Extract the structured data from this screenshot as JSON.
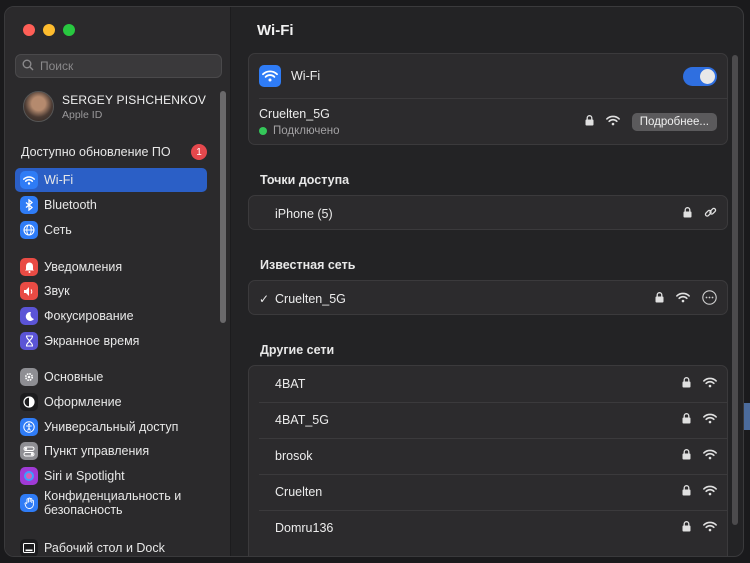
{
  "window": {
    "traffic": [
      "#ff5f57",
      "#febc2e",
      "#28c840"
    ]
  },
  "search": {
    "placeholder": "Поиск"
  },
  "profile": {
    "name": "SERGEY PISHCHENKOV",
    "sub": "Apple ID"
  },
  "update": {
    "label": "Доступно обновление ПО",
    "count": "1"
  },
  "sidebar": {
    "items": [
      {
        "label": "Wi-Fi",
        "icon": "wifi-icon",
        "color": "#2f7cf6",
        "active": true
      },
      {
        "label": "Bluetooth",
        "icon": "bluetooth-icon",
        "color": "#2f7cf6"
      },
      {
        "label": "Сеть",
        "icon": "globe-icon",
        "color": "#2f7cf6"
      },
      {
        "label": "Уведомления",
        "icon": "bell-icon",
        "color": "#e94b44"
      },
      {
        "label": "Звук",
        "icon": "speaker-icon",
        "color": "#e94b44"
      },
      {
        "label": "Фокусирование",
        "icon": "moon-icon",
        "color": "#5b54d6"
      },
      {
        "label": "Экранное время",
        "icon": "hourglass-icon",
        "color": "#5b54d6"
      },
      {
        "label": "Основные",
        "icon": "gear-icon",
        "color": "#8e8e93"
      },
      {
        "label": "Оформление",
        "icon": "appearance-icon",
        "color": "#1c1c1e"
      },
      {
        "label": "Универсальный доступ",
        "icon": "accessibility-icon",
        "color": "#2f7cf6"
      },
      {
        "label": "Пункт управления",
        "icon": "control-center-icon",
        "color": "#8e8e93"
      },
      {
        "label": "Siri и Spotlight",
        "icon": "siri-icon",
        "color": "#a03ad6"
      },
      {
        "label": "Конфиденциальность и безопасность",
        "icon": "hand-icon",
        "color": "#2f7cf6"
      },
      {
        "label": "Рабочий стол и Dock",
        "icon": "dock-icon",
        "color": "#1c1c1e"
      }
    ]
  },
  "main": {
    "title": "Wi-Fi",
    "wifi_label": "Wi-Fi",
    "current": {
      "name": "Cruelten_5G",
      "status": "Подключено",
      "details_button": "Подробнее..."
    },
    "hotspots_title": "Точки доступа",
    "hotspots": [
      {
        "name": "iPhone (5)"
      }
    ],
    "known_title": "Известная сеть",
    "known": [
      {
        "name": "Cruelten_5G",
        "check": "✓"
      }
    ],
    "other_title": "Другие сети",
    "other": [
      {
        "name": "4BAT"
      },
      {
        "name": "4BAT_5G"
      },
      {
        "name": "brosok"
      },
      {
        "name": "Cruelten"
      },
      {
        "name": "Domru136"
      }
    ]
  }
}
